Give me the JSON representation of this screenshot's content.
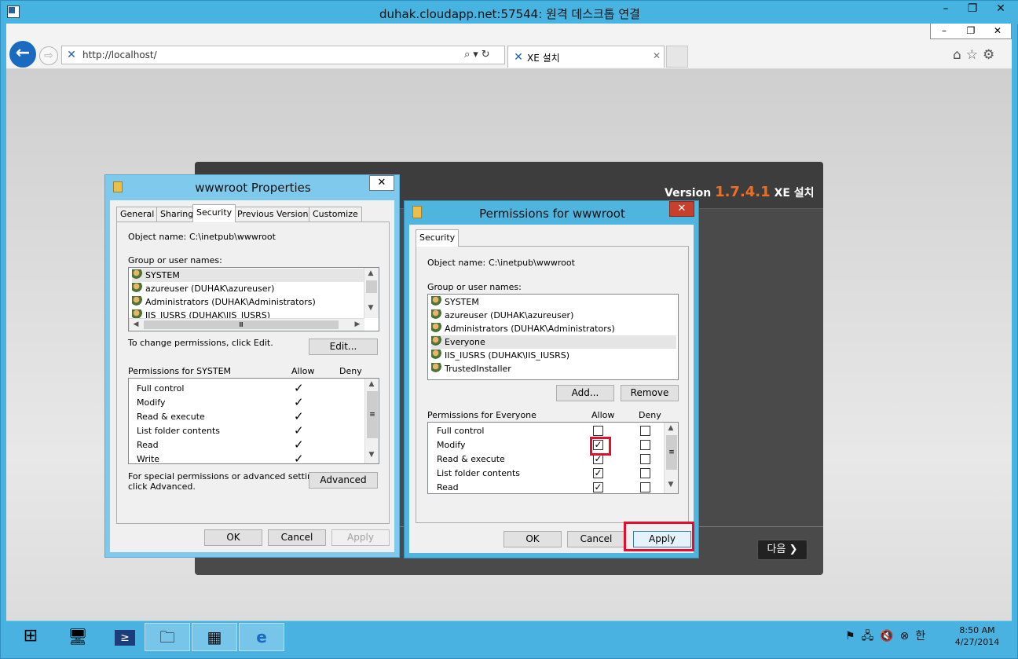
{
  "rdp": {
    "title": "duhak.cloudapp.net:57544: 원격 데스크톱 연결",
    "min": "–",
    "max": "❐",
    "close": "✕"
  },
  "ie": {
    "url": "http://localhost/",
    "tab_title": "XE 설치",
    "tab_close": "✕",
    "win_min": "–",
    "win_max": "❐",
    "win_close": "✕",
    "addr_icons": "⌕▾↻"
  },
  "xe": {
    "version_prefix": "Version",
    "version_number": "1.7.4.1",
    "version_suffix": "XE 설치",
    "next_label": "다음 ❯"
  },
  "props": {
    "title": "wwwroot Properties",
    "close": "✕",
    "tabs": [
      "General",
      "Sharing",
      "Security",
      "Previous Versions",
      "Customize"
    ],
    "object_name_label": "Object name:",
    "object_name_value": "C:\\inetpub\\wwwroot",
    "group_label": "Group or user names:",
    "groups": [
      "SYSTEM",
      "azureuser (DUHAK\\azureuser)",
      "Administrators (DUHAK\\Administrators)",
      "IIS_IUSRS (DUHAK\\IIS_IUSRS)"
    ],
    "change_text": "To change permissions, click Edit.",
    "edit_btn": "Edit...",
    "perm_label": "Permissions for SYSTEM",
    "allow_label": "Allow",
    "deny_label": "Deny",
    "perms": [
      "Full control",
      "Modify",
      "Read & execute",
      "List folder contents",
      "Read",
      "Write"
    ],
    "special_text_1": "For special permissions or advanced settings,",
    "special_text_2": "click Advanced.",
    "advanced_btn": "Advanced",
    "ok": "OK",
    "cancel": "Cancel",
    "apply": "Apply"
  },
  "perm": {
    "title": "Permissions for wwwroot",
    "close": "✕",
    "tab": "Security",
    "object_name_label": "Object name:",
    "object_name_value": "C:\\inetpub\\wwwroot",
    "group_label": "Group or user names:",
    "groups": [
      "SYSTEM",
      "azureuser (DUHAK\\azureuser)",
      "Administrators (DUHAK\\Administrators)",
      "Everyone",
      "IIS_IUSRS (DUHAK\\IIS_IUSRS)",
      "TrustedInstaller"
    ],
    "add_btn": "Add...",
    "remove_btn": "Remove",
    "perm_label": "Permissions for Everyone",
    "allow_label": "Allow",
    "deny_label": "Deny",
    "perms": [
      "Full control",
      "Modify",
      "Read & execute",
      "List folder contents",
      "Read"
    ],
    "ok": "OK",
    "cancel": "Cancel",
    "apply": "Apply"
  },
  "taskbar": {
    "clock_time": "8:50 AM",
    "clock_date": "4/27/2014",
    "ime": "한"
  },
  "colors": {
    "accent_red": "#e2102e",
    "xe_orange": "#f26e1e",
    "rdp_blue": "#47b3e1"
  }
}
